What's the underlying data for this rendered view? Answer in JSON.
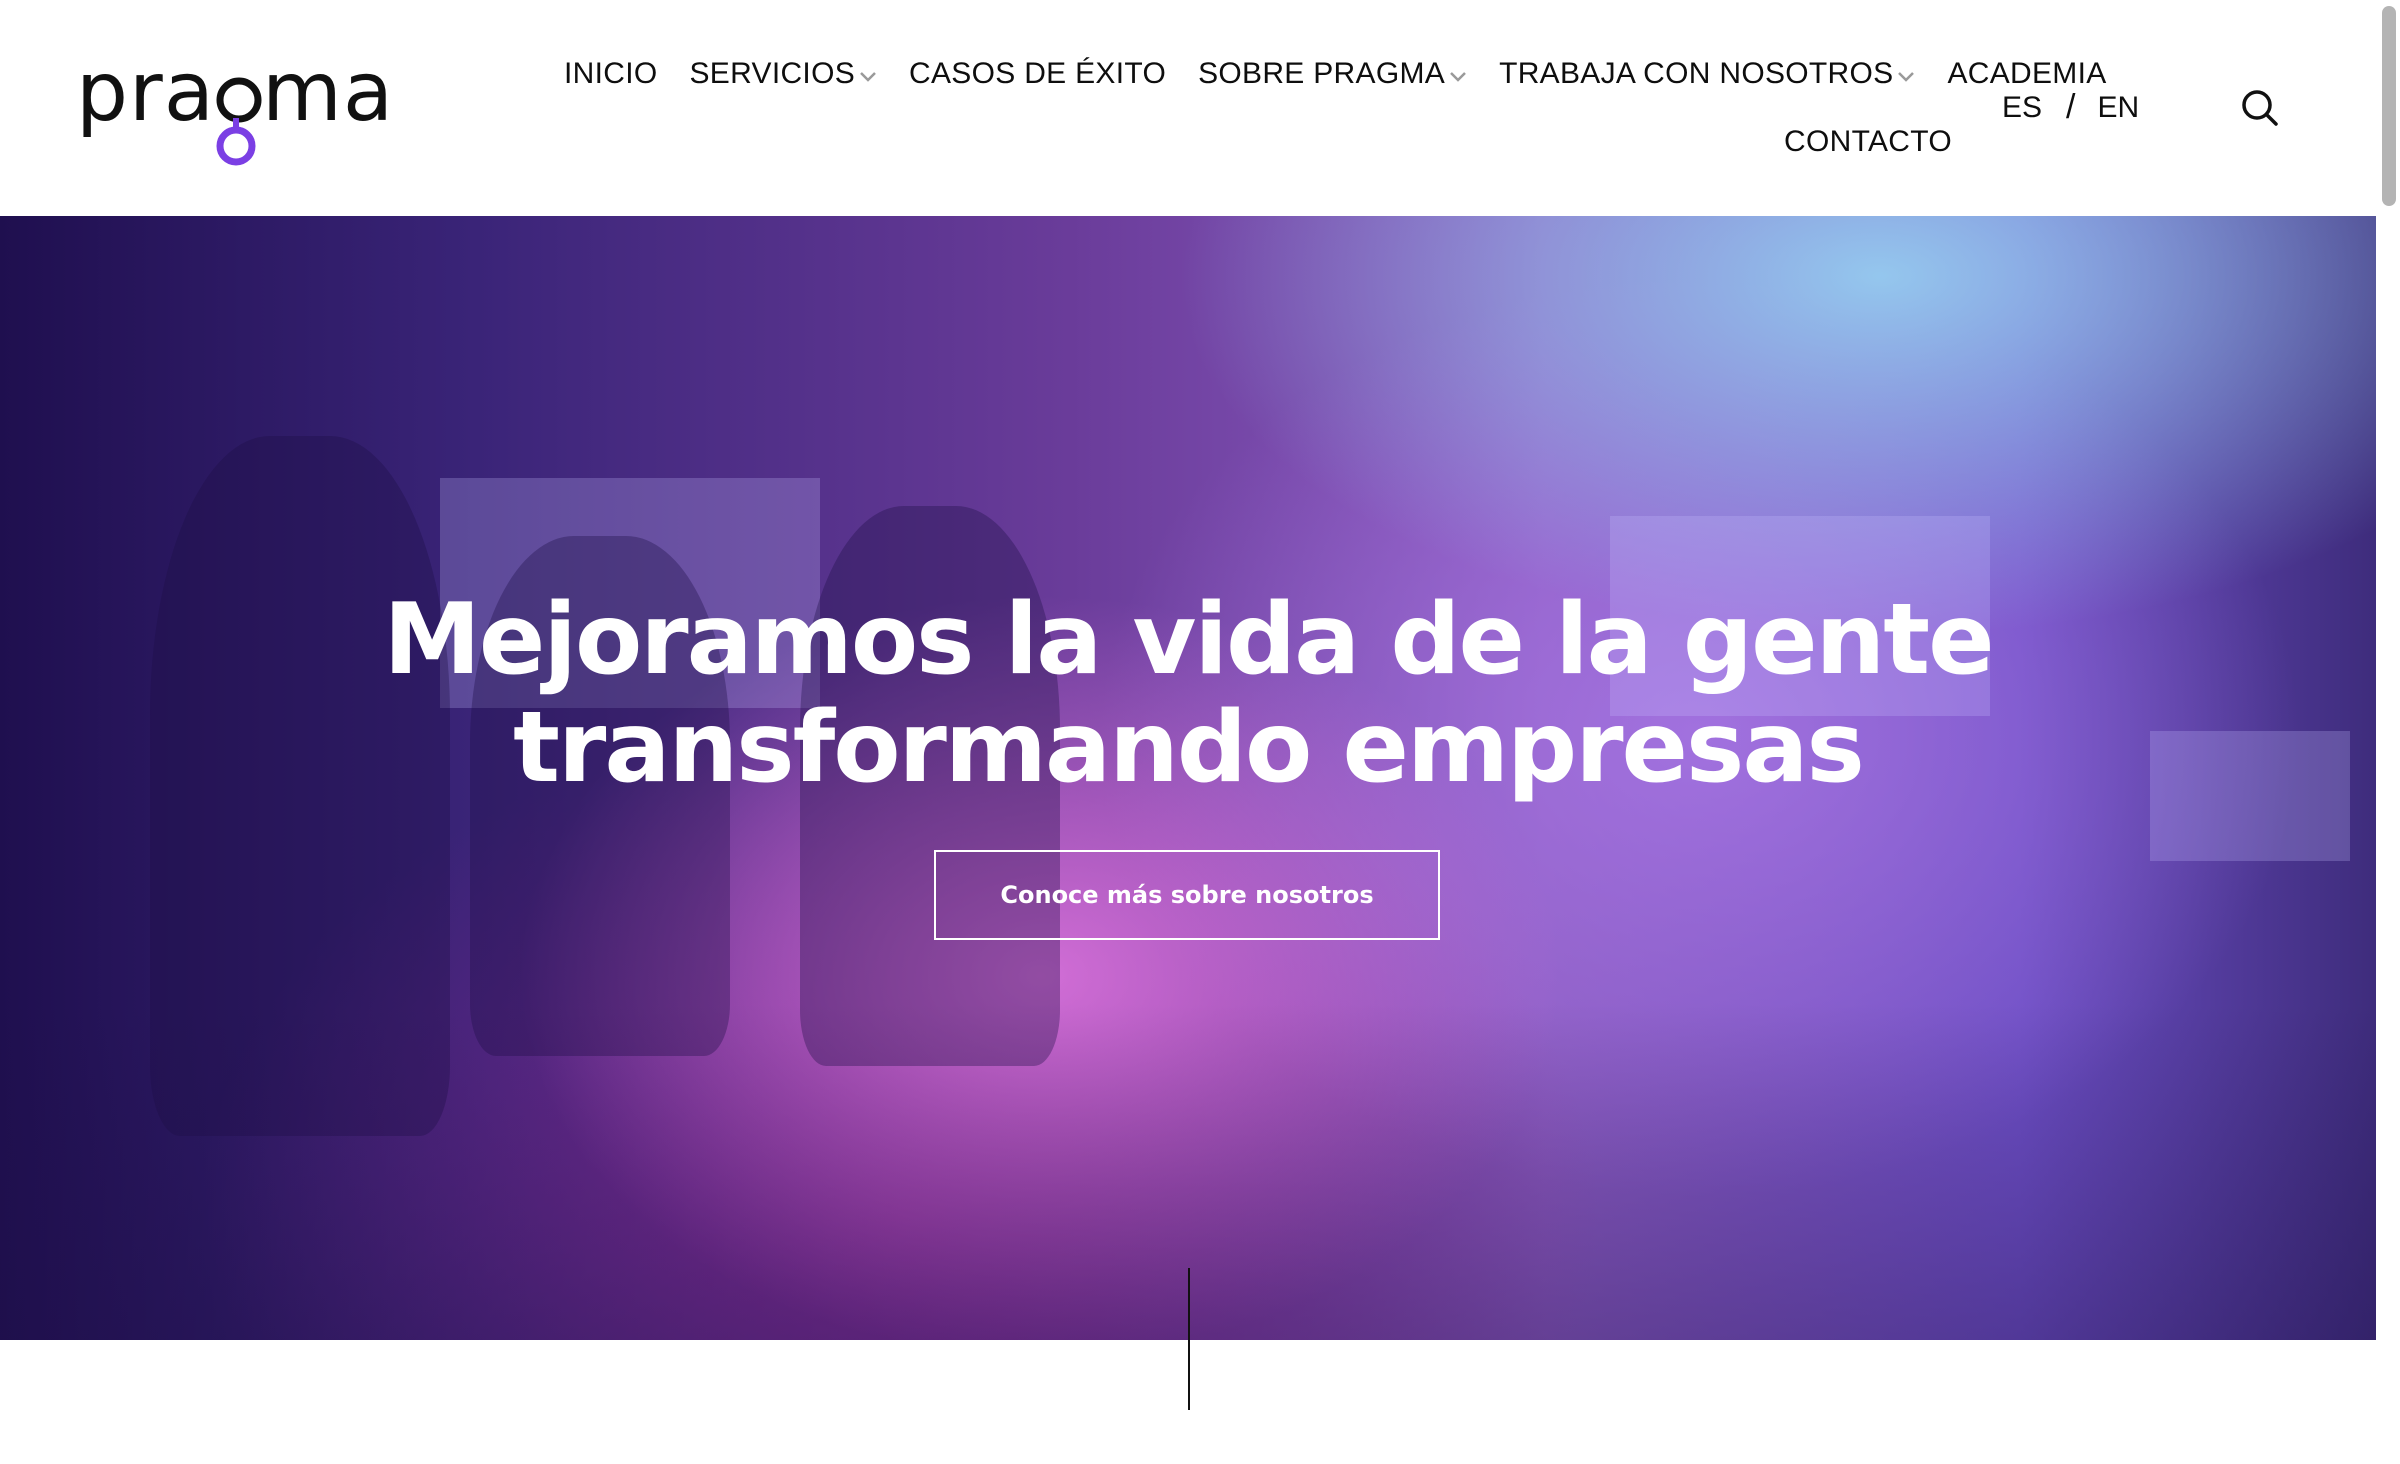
{
  "header": {
    "logo_text": "pragma",
    "nav_row1": [
      {
        "label": "INICIO",
        "dropdown": false
      },
      {
        "label": "SERVICIOS",
        "dropdown": true
      },
      {
        "label": "CASOS DE ÉXITO",
        "dropdown": false
      },
      {
        "label": "SOBRE PRAGMA",
        "dropdown": true
      },
      {
        "label": "TRABAJA CON NOSOTROS",
        "dropdown": true
      },
      {
        "label": "ACADEMIA",
        "dropdown": false
      }
    ],
    "nav_row2": [
      {
        "label": "CONTACTO",
        "dropdown": false
      }
    ],
    "lang": {
      "es": "ES",
      "separator": "/",
      "en": "EN"
    },
    "search_icon": "search-icon"
  },
  "hero": {
    "headline_line1": "Mejoramos la vida de la gente",
    "headline_line2": "transformando empresas",
    "cta_label": "Conoce más sobre nosotros"
  },
  "colors": {
    "brand_purple": "#7b3fe4",
    "text_dark": "#0e0e0e",
    "chevron_gray": "#9a9a9a"
  }
}
